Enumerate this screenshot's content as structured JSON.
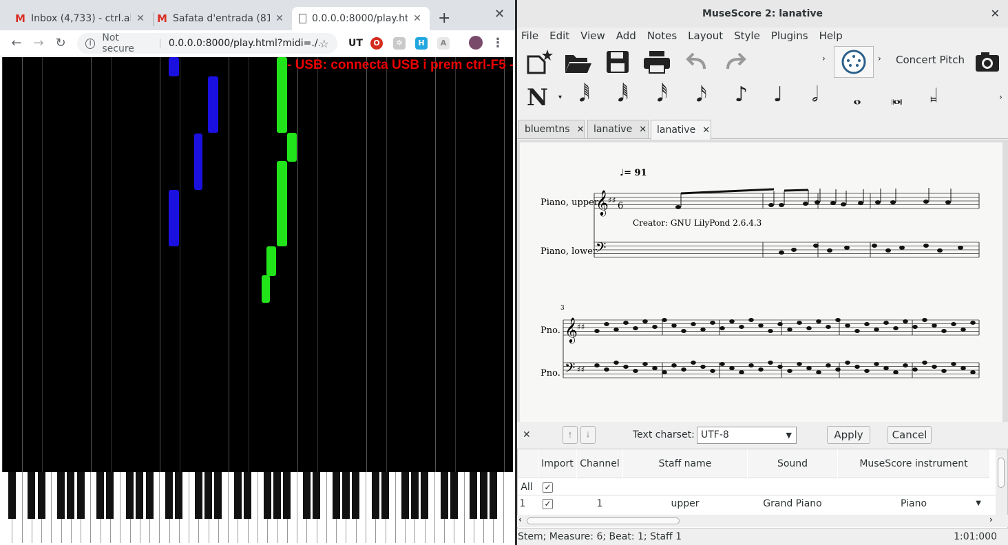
{
  "browser": {
    "tabs": [
      {
        "label": "Inbox (4,733) - ctrl.al",
        "icon": "gmail-icon"
      },
      {
        "label": "Safata d'entrada (81",
        "icon": "gmail-icon"
      },
      {
        "label": "0.0.0.0:8000/play.ht",
        "icon": "document-icon"
      }
    ],
    "address": {
      "security": "Not secure",
      "url": "0.0.0.0:8000/play.html?midi=./..."
    },
    "banner": "- USB: connecta USB i prem ctrl-F5 -"
  },
  "musescore": {
    "title": "MuseScore 2: lanative",
    "menu": [
      "File",
      "Edit",
      "View",
      "Add",
      "Notes",
      "Layout",
      "Style",
      "Plugins",
      "Help"
    ],
    "concert_pitch": "Concert Pitch",
    "tabs": [
      "bluemtns",
      "lanative",
      "lanative"
    ],
    "score": {
      "tempo": "♩= 91",
      "staff1_upper": "Piano, upper",
      "staff1_lower": "Piano, lower",
      "creator": "Creator: GNU LilyPond 2.6.4.3",
      "measure_number": "3",
      "staff2_upper": "Pno.",
      "staff2_lower": "Pno."
    },
    "import": {
      "charset_label": "Text charset:",
      "charset_value": "UTF-8",
      "apply": "Apply",
      "cancel": "Cancel",
      "columns": [
        "Import",
        "Channel",
        "Staff name",
        "Sound",
        "MuseScore instrument"
      ],
      "rows": [
        {
          "label": "All",
          "import": true,
          "channel": "",
          "staff": "",
          "sound": "",
          "instrument": ""
        },
        {
          "label": "1",
          "import": true,
          "channel": "1",
          "staff": "upper",
          "sound": "Grand Piano",
          "instrument": "Piano"
        }
      ]
    },
    "status": {
      "left": "Stem;  Measure: 6; Beat: 1; Staff 1",
      "right": "1:01:000"
    }
  },
  "colors": {
    "right_hand": "#1a10e0",
    "left_hand": "#22e41a",
    "banner": "#e00000"
  }
}
